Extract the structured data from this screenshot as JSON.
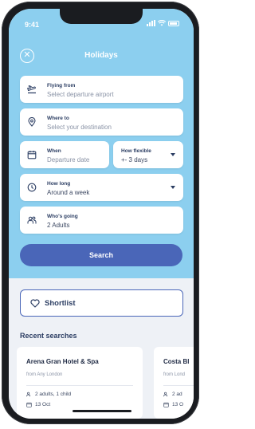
{
  "status_bar": {
    "time": "9:41"
  },
  "header": {
    "title": "Holidays"
  },
  "fields": {
    "flying_from": {
      "label": "Flying from",
      "placeholder": "Select departure airport"
    },
    "where_to": {
      "label": "Where to",
      "placeholder": "Select your destination"
    },
    "when": {
      "label": "When",
      "placeholder": "Departure date"
    },
    "how_flexible": {
      "label": "How flexible",
      "value": "+- 3 days"
    },
    "how_long": {
      "label": "How long",
      "value": "Around a week"
    },
    "whos_going": {
      "label": "Who's going",
      "value": "2 Adults"
    }
  },
  "search_button": {
    "label": "Search"
  },
  "shortlist_button": {
    "label": "Shortlist"
  },
  "recent_searches": {
    "title": "Recent searches",
    "items": [
      {
        "name": "Arena Gran Hotel & Spa",
        "from": "from Any London",
        "guests": "2 adults, 1 child",
        "date": "13 Oct"
      },
      {
        "name": "Costa Bl",
        "from": "from Lond",
        "guests": "2 ad",
        "date": "13 O"
      }
    ]
  },
  "colors": {
    "hero": "#8ccfef",
    "accent": "#4a66b8",
    "text_dark": "#2c3e63"
  }
}
